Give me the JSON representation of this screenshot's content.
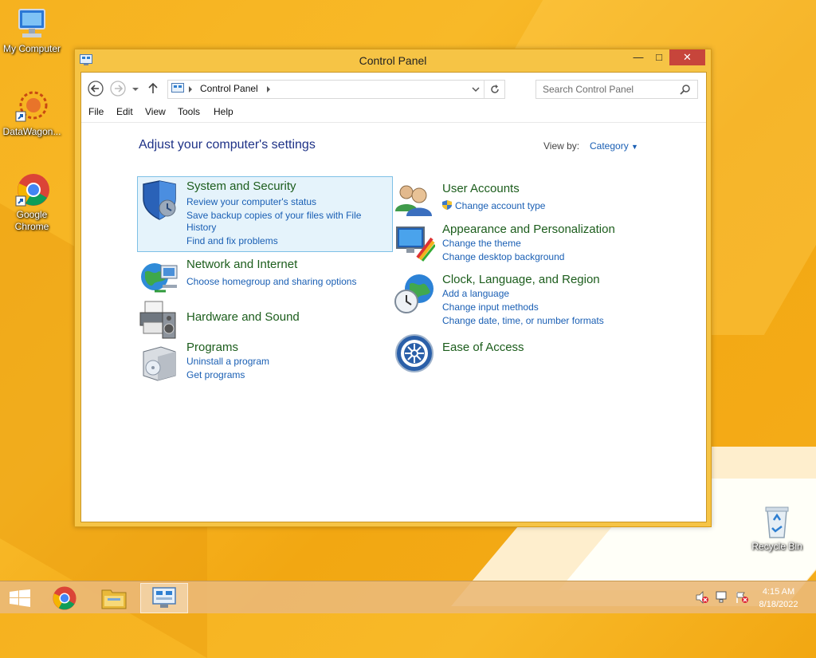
{
  "desktop": {
    "icons": [
      {
        "label": "My Computer",
        "icon": "my-computer-icon"
      },
      {
        "label": "DataWagon...",
        "icon": "datawagon-shortcut-icon"
      },
      {
        "label": "Google Chrome",
        "icon": "chrome-icon"
      },
      {
        "label": "Recycle Bin",
        "icon": "recycle-bin-icon"
      }
    ]
  },
  "window": {
    "title": "Control Panel",
    "address": {
      "breadcrumb": "Control Panel"
    },
    "search_placeholder": "Search Control Panel",
    "menu": [
      "File",
      "Edit",
      "View",
      "Tools",
      "Help"
    ],
    "heading": "Adjust your computer's settings",
    "view_by_label": "View by:",
    "view_by_value": "Category",
    "categories": {
      "system": {
        "title": "System and Security",
        "links": [
          "Review your computer's status",
          "Save backup copies of your files with File",
          "History",
          "Find and fix problems"
        ]
      },
      "network": {
        "title": "Network and Internet",
        "links": [
          "Choose homegroup and sharing options"
        ]
      },
      "hardware": {
        "title": "Hardware and Sound"
      },
      "programs": {
        "title": "Programs",
        "links": [
          "Uninstall a program",
          "Get programs"
        ]
      },
      "users": {
        "title": "User Accounts",
        "links": [
          "Change account type"
        ]
      },
      "appearance": {
        "title": "Appearance and Personalization",
        "links": [
          "Change the theme",
          "Change desktop background"
        ]
      },
      "clock": {
        "title": "Clock, Language, and Region",
        "links": [
          "Add a language",
          "Change input methods",
          "Change date, time, or number formats"
        ]
      },
      "ease": {
        "title": "Ease of Access"
      }
    }
  },
  "taskbar": {
    "time": "4:15 AM",
    "date": "8/18/2022"
  },
  "colors": {
    "desktop_bg": "#f6b21f",
    "window_frame": "#f6c445",
    "close_button": "#c7453b",
    "category_title": "#1c5d1c",
    "link": "#1a5fb4",
    "heading": "#1e3287"
  }
}
